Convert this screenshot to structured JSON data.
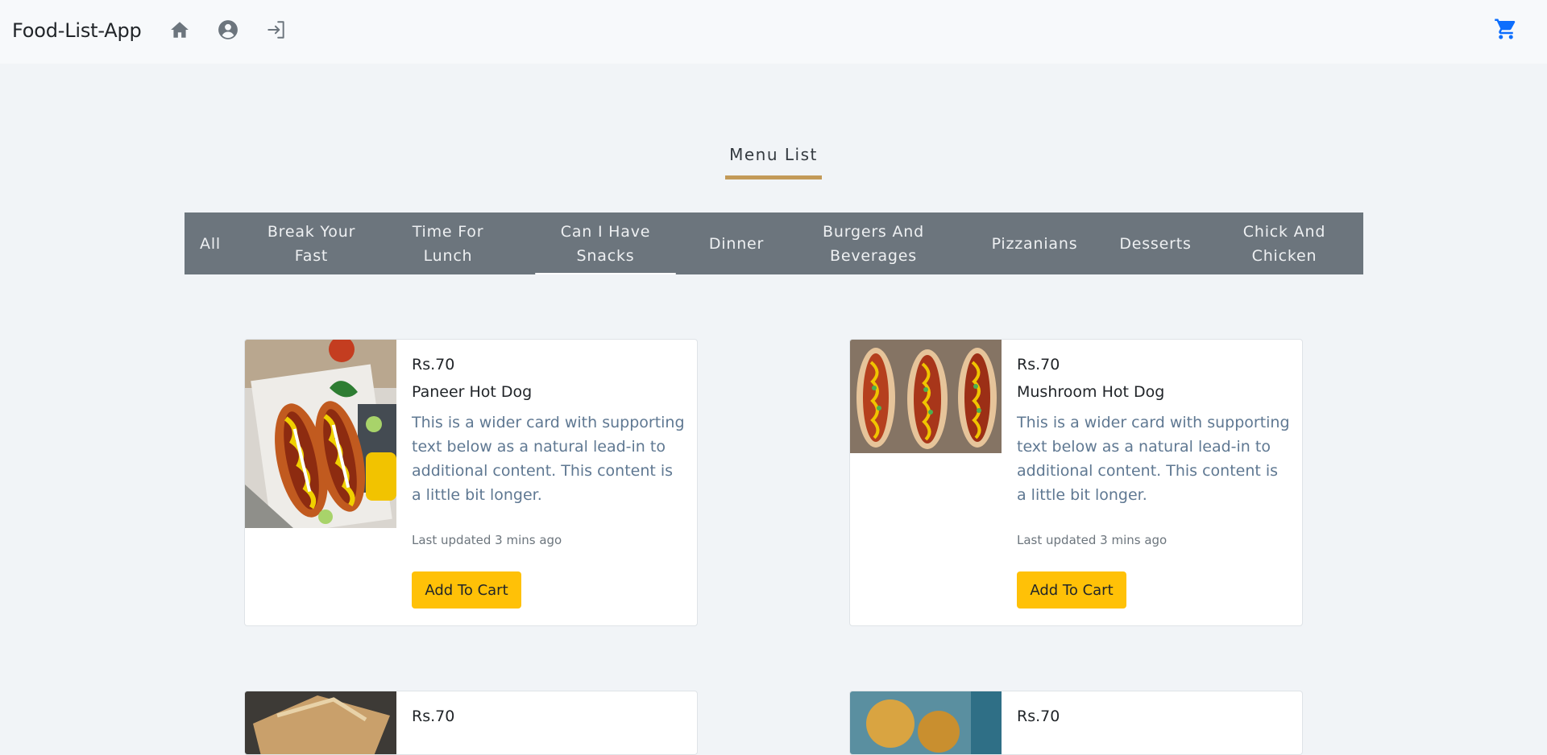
{
  "navbar": {
    "brand": "Food-List-App",
    "icons": [
      "home-icon",
      "account-icon",
      "login-icon",
      "cart-icon"
    ],
    "cart_color": "#0d6efd"
  },
  "heading": {
    "title": "Menu List",
    "underline_color": "#c39a58"
  },
  "tabs": [
    {
      "label": "All",
      "active": false
    },
    {
      "label": "Break Your Fast",
      "active": false
    },
    {
      "label": "Time For Lunch",
      "active": false
    },
    {
      "label": "Can I Have Snacks",
      "active": true
    },
    {
      "label": "Dinner",
      "active": false
    },
    {
      "label": "Burgers And Beverages",
      "active": false
    },
    {
      "label": "Pizzanians",
      "active": false
    },
    {
      "label": "Desserts",
      "active": false
    },
    {
      "label": "Chick And Chicken",
      "active": false
    }
  ],
  "cards": [
    {
      "price": "Rs.70",
      "title": "Paneer Hot Dog",
      "description": "This is a wider card with supporting text below as a natural lead-in to additional content. This content is a little bit longer.",
      "updated": "Last updated 3 mins ago",
      "button": "Add To Cart"
    },
    {
      "price": "Rs.70",
      "title": "Mushroom Hot Dog",
      "description": "This is a wider card with supporting text below as a natural lead-in to additional content. This content is a little bit longer.",
      "updated": "Last updated 3 mins ago",
      "button": "Add To Cart"
    }
  ],
  "partial_cards": [
    {
      "price": "Rs.70"
    },
    {
      "price": "Rs.70"
    }
  ],
  "colors": {
    "tab_bar": "#6c757d",
    "button": "#ffc107",
    "page_bg": "#f1f4f7"
  }
}
